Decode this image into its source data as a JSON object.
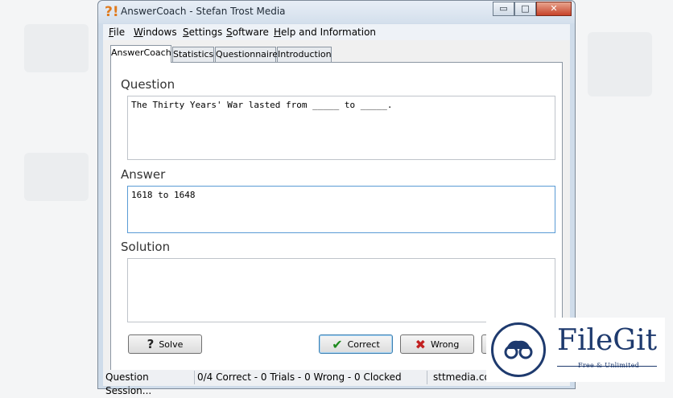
{
  "window": {
    "title": "AnswerCoach - Stefan Trost Media",
    "min": "▭",
    "max": "□",
    "close": "✕"
  },
  "menu": [
    {
      "label": "File",
      "u": "F",
      "rest": "ile"
    },
    {
      "label": "Windows",
      "u": "W",
      "rest": "indows"
    },
    {
      "label": "Settings",
      "u": "S",
      "rest": "ettings"
    },
    {
      "label": "Software",
      "u": "S",
      "rest": "oftware"
    },
    {
      "label": "Help and Information",
      "u": "H",
      "rest": "elp and Information"
    }
  ],
  "tabs": [
    "AnswerCoach",
    "Statistics",
    "Questionnaire",
    "Introduction"
  ],
  "question": {
    "label": "Question",
    "text": "The Thirty Years' War lasted from _____ to _____."
  },
  "answer": {
    "label": "Answer",
    "text": "1618 to 1648"
  },
  "solution": {
    "label": "Solution",
    "text": ""
  },
  "buttons": {
    "solve": "Solve",
    "correct": "Correct",
    "wrong": "Wrong"
  },
  "status": {
    "session": "Question Session...",
    "stats": "0/4 Correct - 0 Trials - 0 Wrong - 0 Clocked",
    "site": "sttmedia.com"
  },
  "watermark": {
    "name": "FileGit",
    "tagline": "Free & Unlimited"
  }
}
